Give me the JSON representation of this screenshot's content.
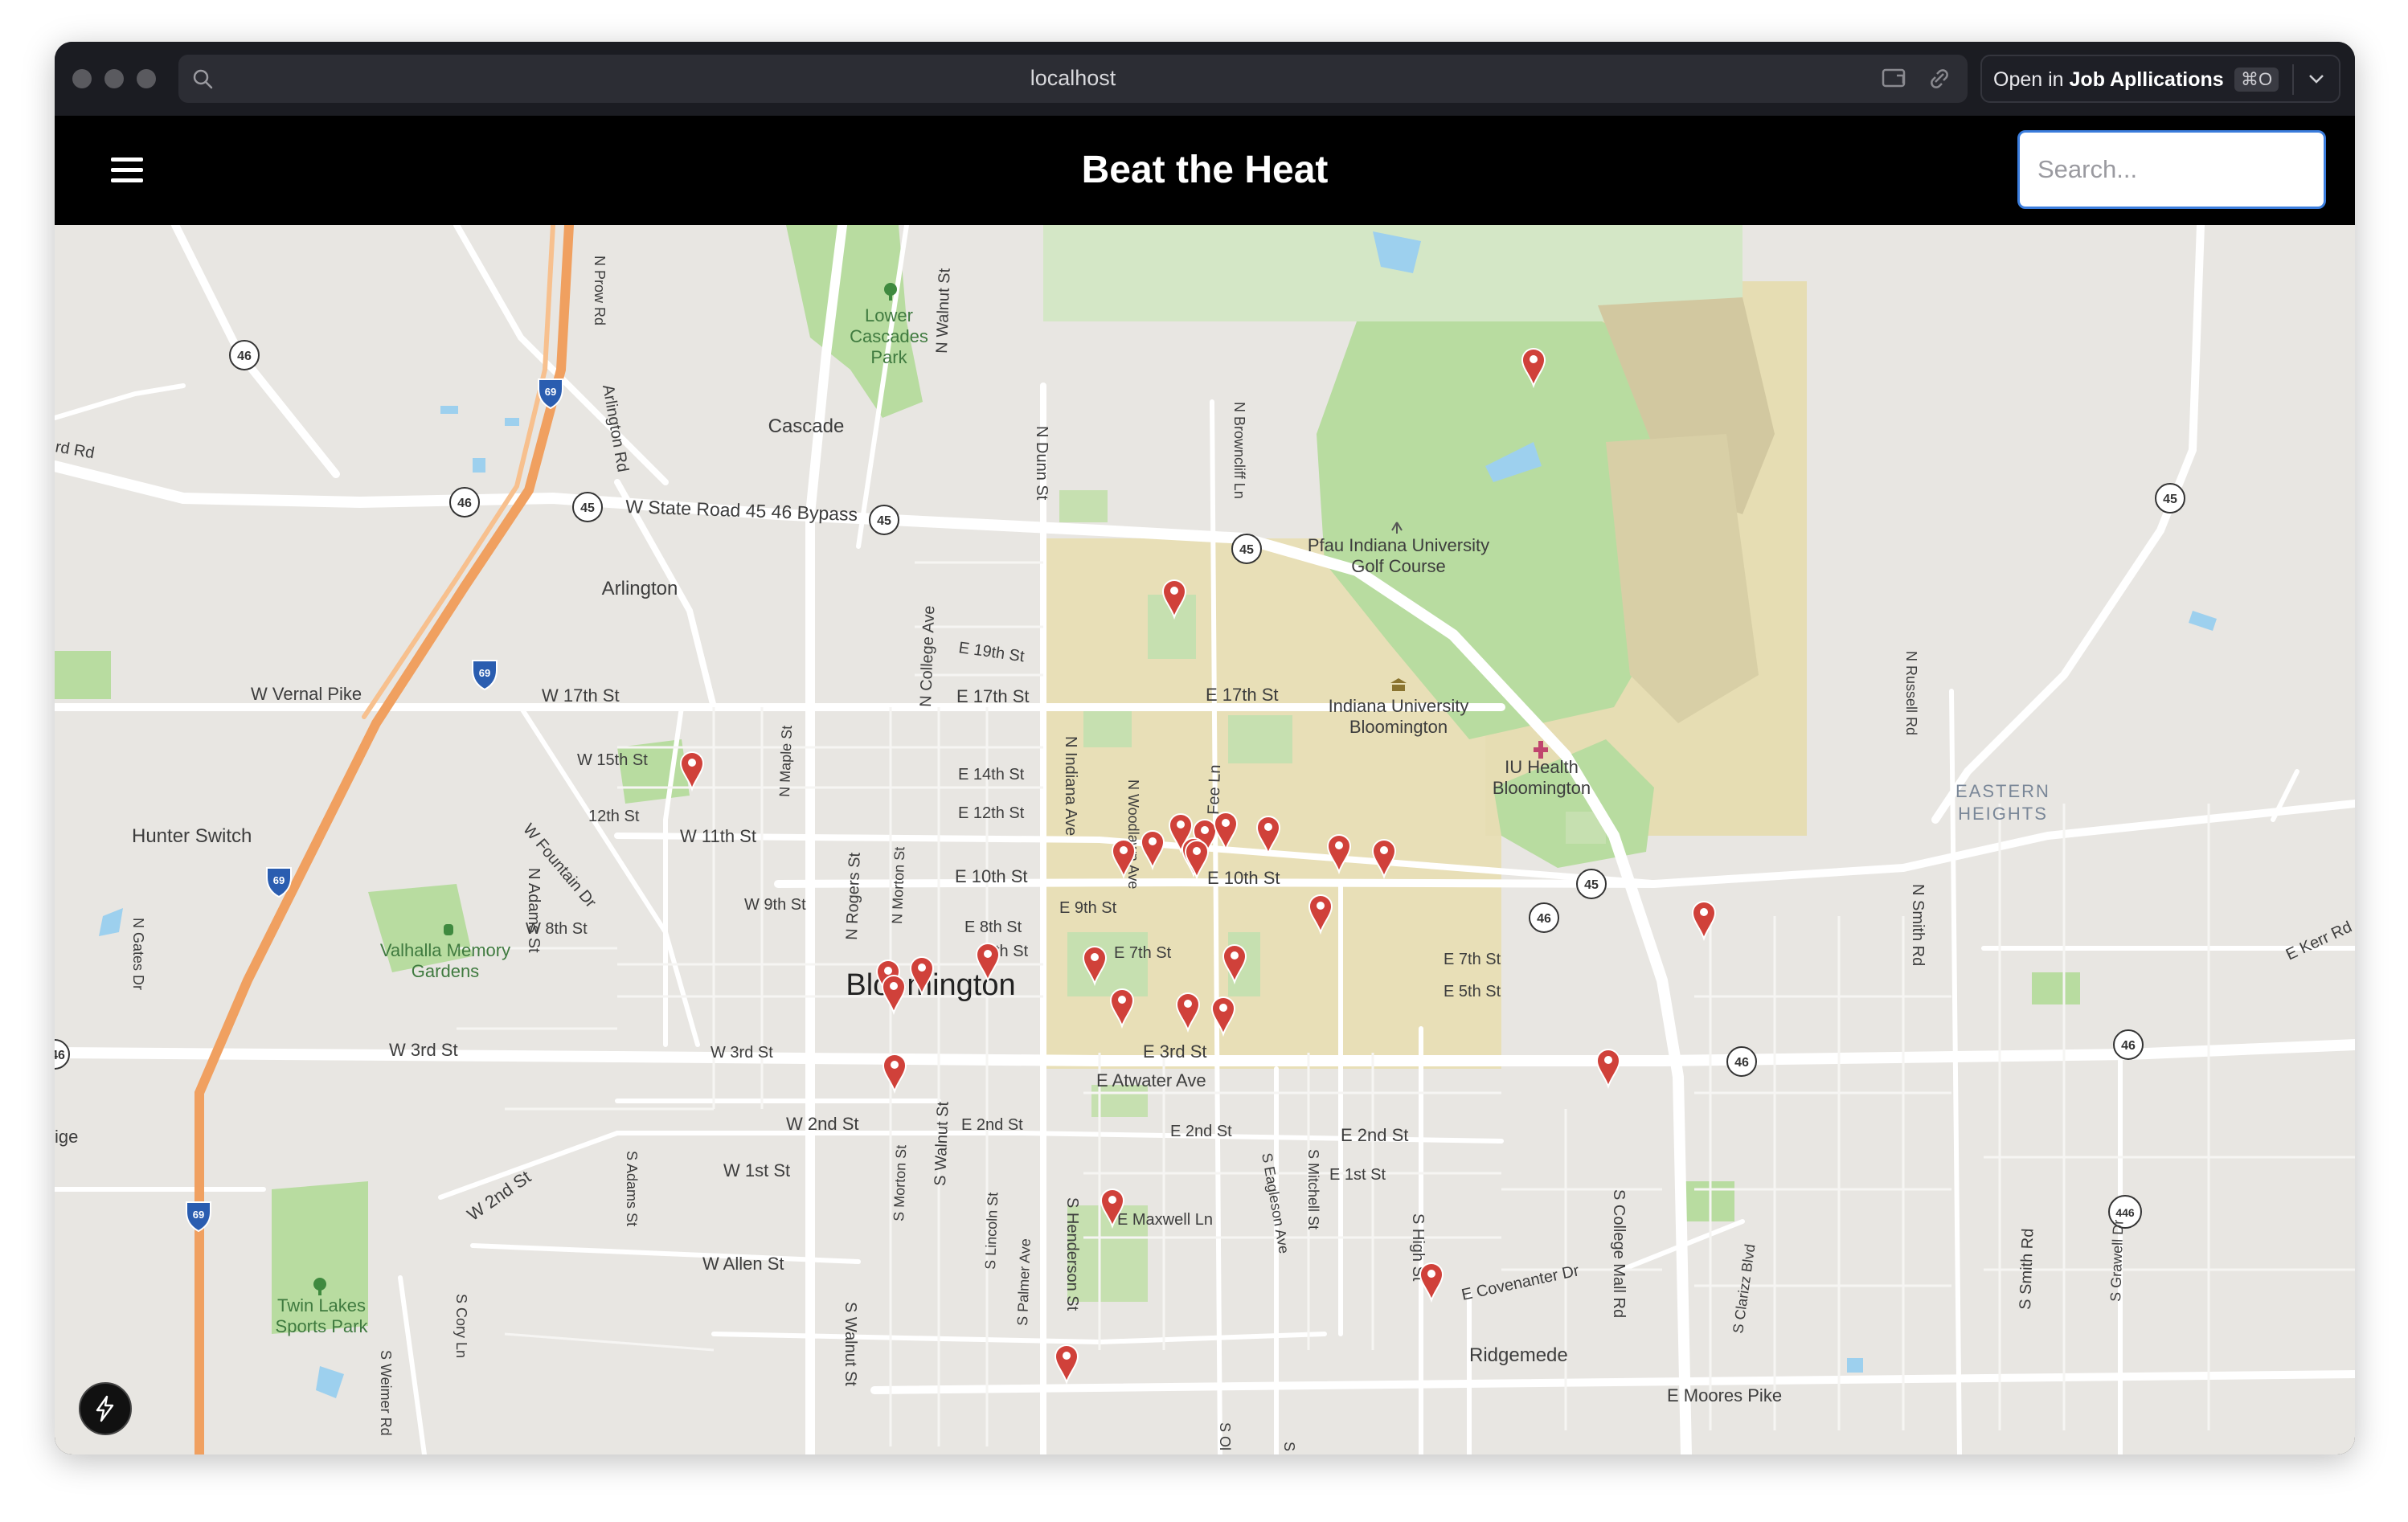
{
  "browser": {
    "url": "localhost",
    "open_in_prefix": "Open in",
    "open_in_app": "Job Apllications",
    "shortcut": "⌘O",
    "icons": [
      "search-icon",
      "cast-icon",
      "link-icon",
      "chevron-down-icon"
    ]
  },
  "app": {
    "title": "Beat the Heat",
    "menu_icon": "hamburger-menu-icon",
    "search": {
      "placeholder": "Search...",
      "value": ""
    }
  },
  "map": {
    "labels": {
      "lower_cascades_park_1": "Lower",
      "lower_cascades_park_2": "Cascades",
      "lower_cascades_park_3": "Park",
      "cascade": "Cascade",
      "state_road": "W State Road 45 46 Bypass",
      "arlington": "Arlington",
      "arlington_rd": "Arlington Rd",
      "n_prow_rd": "N Prow Rd",
      "rd_rd": "rd Rd",
      "w_vernal_pike": "W Vernal Pike",
      "w_17th_st": "W 17th St",
      "e_17th_st_a": "E 17th St",
      "e_17th_st_b": "E 17th St",
      "e_19th_st": "E 19th St",
      "w_15th_st": "W 15th St",
      "12th_st": "12th St",
      "w_11th_st": "W 11th St",
      "e_14th_st": "E 14th St",
      "e_12th_st": "E 12th St",
      "e_10th_st_a": "E 10th St",
      "e_10th_st_b": "E 10th St",
      "w_9th_st": "W 9th St",
      "e_9th_st": "E 9th St",
      "w_8th_st": "W 8th St",
      "e_8th_st": "E 8th St",
      "e_7th_st_a": "E 7th St",
      "e_7th_st_b": "E 7th St",
      "th_st": "th St",
      "e_5th_st": "E 5th St",
      "w_3rd_st_a": "W 3rd St",
      "w_3rd_st_b": "W 3rd St",
      "e_3rd_st": "E 3rd St",
      "e_atwater_ave": "E Atwater Ave",
      "w_2nd_st_a": "W 2nd St",
      "w_2nd_st_b": "W 2nd St",
      "e_2nd_st_a": "E 2nd St",
      "e_2nd_st_b": "E 2nd St",
      "e_2nd_st_c": "E 2nd St",
      "w_1st_st": "W 1st St",
      "e_1st_st": "E 1st St",
      "e_maxwell_ln": "E Maxwell Ln",
      "w_allen_st": "W Allen St",
      "e_covenanter_dr": "E Covenanter Dr",
      "ridgemede": "Ridgemede",
      "e_moores_pike": "E Moores Pike",
      "e_kerr_rd": "E Kerr Rd",
      "hunter_switch": "Hunter Switch",
      "w_fountain_dr": "W Fountain Dr",
      "valhalla_1": "Valhalla Memory",
      "valhalla_2": "Gardens",
      "twin_lakes_1": "Twin Lakes",
      "twin_lakes_2": "Sports Park",
      "bloomington": "Bloomington",
      "pfau_1": "Pfau Indiana University",
      "pfau_2": "Golf Course",
      "iu_1": "Indiana University",
      "iu_2": "Bloomington",
      "iu_health_1": "IU Health",
      "iu_health_2": "Bloomington",
      "eastern_1": "EASTERN",
      "eastern_2": "HEIGHTS",
      "ige": "ige",
      "n_walnut_st": "N Walnut St",
      "n_dunn_st": "N Dunn St",
      "n_brownclif_ln": "N Browncliff Ln",
      "n_college_ave": "N College Ave",
      "n_maple_st": "N Maple St",
      "n_rogers_st": "N Rogers St",
      "n_morton_st": "N Morton St",
      "n_adams_st": "N Adams St",
      "n_gates_dr": "N Gates Dr",
      "n_indiana_ave": "N Indiana Ave",
      "n_woodlawn_ave": "N Woodlawn Ave",
      "fee_ln": "Fee Ln",
      "n_russell_rd": "N Russell Rd",
      "n_smith_rd": "N Smith Rd",
      "s_walnut_st_a": "S Walnut St",
      "s_walnut_st_b": "S Walnut St",
      "s_morton_st": "S Morton St",
      "s_adams_st": "S Adams St",
      "s_lincoln_st": "S Lincoln St",
      "s_henderson_st": "S Henderson St",
      "s_palmer_ave": "S Palmer Ave",
      "s_eagleson_ave": "S Eagleson Ave",
      "s_mitchell_st": "S Mitchell St",
      "s_high_st": "S High St",
      "s_college_mall_rd": "S College Mall Rd",
      "s_clarizz_blvd": "S Clarizz Blvd",
      "s_smith_rd": "S Smith Rd",
      "s_grawell_dr": "S Grawell Dr",
      "s_cory_ln": "S Cory Ln",
      "s_weimer_rd": "S Weimer Rd",
      "s_ol": "S Ol",
      "s_cut": "S"
    },
    "shields": {
      "s46a": "46",
      "s46b": "46",
      "s45a": "45",
      "s45b": "45",
      "s45c": "45",
      "s45d": "45",
      "s46c": "46",
      "s45e": "45",
      "s46d": "46",
      "s46e": "46",
      "s46f": "46",
      "s446": "446",
      "s69a": "69",
      "s69b": "69",
      "s69c": "69",
      "s69d": "69"
    },
    "marker_color": "#d0413a",
    "marker_count": 29
  },
  "dev_tool": {
    "icon": "lightning-bolt-icon"
  }
}
